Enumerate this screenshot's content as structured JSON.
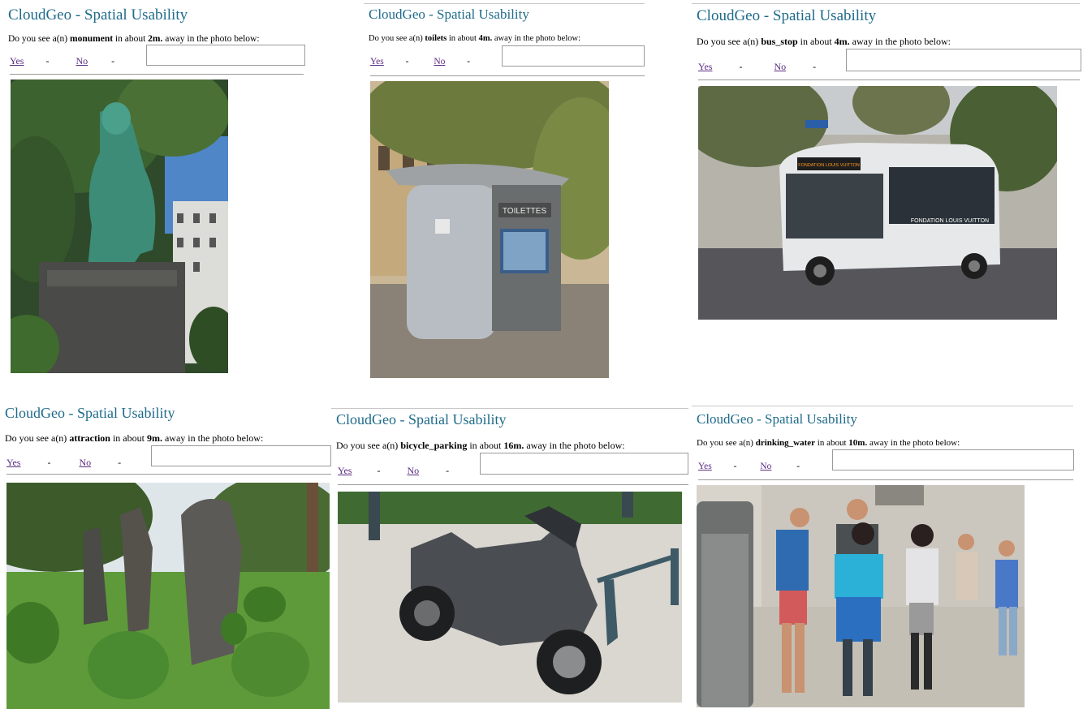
{
  "panels": [
    {
      "title": "CloudGeo - Spatial Usability",
      "q_prefix": "Do you see a(n) ",
      "object": "monument",
      "q_mid": " in about ",
      "distance": "2m.",
      "q_suffix": " away in the photo below:",
      "yes": "Yes",
      "no": "No",
      "sep": "-",
      "photo_icon": "statue-photo"
    },
    {
      "title": "CloudGeo - Spatial Usability",
      "q_prefix": "Do you see a(n) ",
      "object": "toilets",
      "q_mid": " in about ",
      "distance": "4m.",
      "q_suffix": " away in the photo below:",
      "yes": "Yes",
      "no": "No",
      "sep": "-",
      "photo_icon": "public-toilet-photo",
      "sign": "TOILETTES"
    },
    {
      "title": "CloudGeo - Spatial Usability",
      "q_prefix": "Do you see a(n) ",
      "object": "bus_stop",
      "q_mid": " in about ",
      "distance": "4m.",
      "q_suffix": " away in the photo below:",
      "yes": "Yes",
      "no": "No",
      "sep": "-",
      "photo_icon": "bus-photo",
      "bus_sign": "FONDATION LOUIS VUITTON",
      "bus_side": "FONDATION LOUIS VUITTON"
    },
    {
      "title": "CloudGeo - Spatial Usability",
      "q_prefix": "Do you see a(n) ",
      "object": "attraction",
      "q_mid": " in about ",
      "distance": "9m.",
      "q_suffix": " away in the photo below:",
      "yes": "Yes",
      "no": "No",
      "sep": "-",
      "photo_icon": "sculpture-garden-photo"
    },
    {
      "title": "CloudGeo - Spatial Usability",
      "q_prefix": "Do you see a(n) ",
      "object": "bicycle_parking",
      "q_mid": " in about ",
      "distance": "16m.",
      "q_suffix": " away in the photo below:",
      "yes": "Yes",
      "no": "No",
      "sep": "-",
      "photo_icon": "scooter-photo"
    },
    {
      "title": "CloudGeo - Spatial Usability",
      "q_prefix": "Do you see a(n) ",
      "object": "drinking_water",
      "q_mid": " in about ",
      "distance": "10m.",
      "q_suffix": " away in the photo below:",
      "yes": "Yes",
      "no": "No",
      "sep": "-",
      "photo_icon": "people-fountain-photo"
    }
  ],
  "colors": {
    "title": "#1e6a8a",
    "link": "#5a2a82",
    "border": "#9a9a9a"
  }
}
